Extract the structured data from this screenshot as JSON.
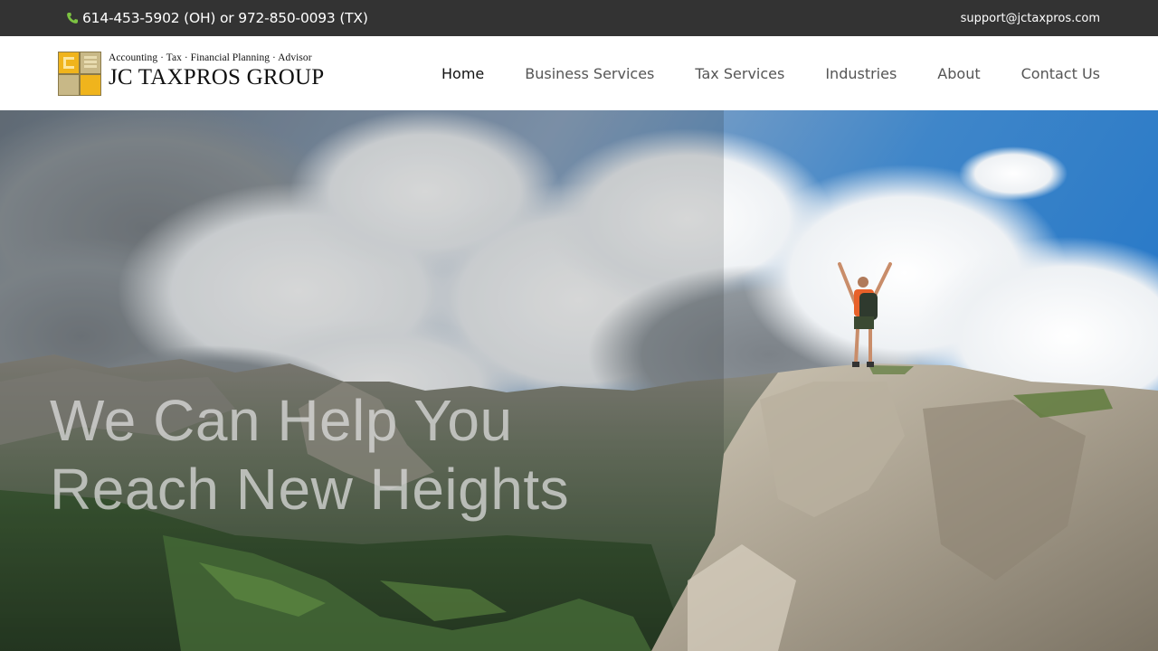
{
  "topbar": {
    "phone_text": "614-453-5902 (OH) or 972-850-0093 (TX)",
    "email": "support@jctaxpros.com",
    "phone_icon": "phone-icon",
    "phone_icon_color": "#7cc242"
  },
  "logo": {
    "tagline": "Accounting · Tax · Financial Planning · Advisor",
    "name": "JC TAXPROS GROUP",
    "colors": {
      "gold": "#f0b41c",
      "tan": "#c8b887"
    }
  },
  "nav": {
    "items": [
      {
        "label": "Home",
        "active": true
      },
      {
        "label": "Business Services",
        "active": false
      },
      {
        "label": "Tax Services",
        "active": false
      },
      {
        "label": "Industries",
        "active": false
      },
      {
        "label": "About",
        "active": false
      },
      {
        "label": "Contact Us",
        "active": false
      }
    ]
  },
  "hero": {
    "line1": "We Can Help You",
    "line2": "Reach New Heights"
  }
}
